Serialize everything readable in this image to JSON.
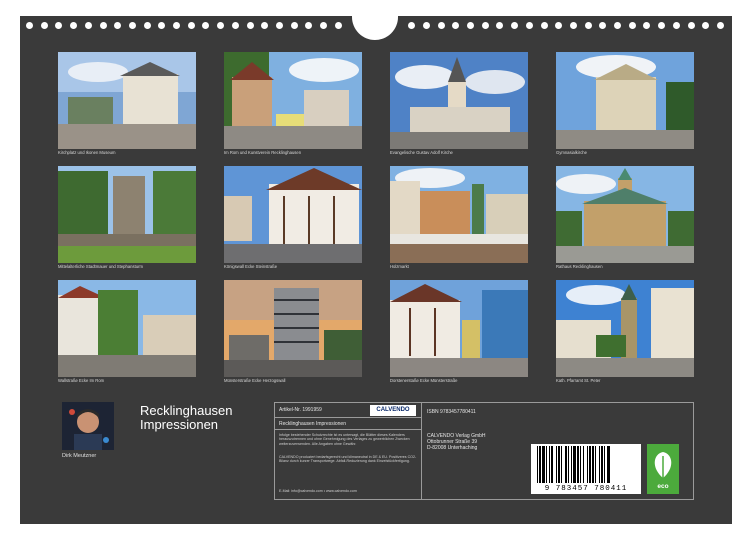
{
  "photos": [
    {
      "caption": "Kirchplatz und Ikonen Museum",
      "icon": "photo-kirchplatz"
    },
    {
      "caption": "Im Rom und Kunstverein Recklinghausen",
      "icon": "photo-im-rom"
    },
    {
      "caption": "Evangelische Gustav Adolf Kirche",
      "icon": "photo-gustav-adolf-kirche"
    },
    {
      "caption": "Gymnasialkirche",
      "icon": "photo-gymnasialkirche"
    },
    {
      "caption": "Mittelalterliche Stadtmauer und Stephansturm",
      "icon": "photo-stadtmauer"
    },
    {
      "caption": "Königswall Ecke Steinstraße",
      "icon": "photo-koenigswall"
    },
    {
      "caption": "Holzmarkt",
      "icon": "photo-holzmarkt"
    },
    {
      "caption": "Rathaus Recklinghausen",
      "icon": "photo-rathaus"
    },
    {
      "caption": "Wallstraße Ecke Im Rom",
      "icon": "photo-wallstrasse"
    },
    {
      "caption": "Münsterstraße Ecke Herzogswall",
      "icon": "photo-muensterstrasse"
    },
    {
      "caption": "Dorstenerstaße Ecke Münsterstraße",
      "icon": "photo-dorstener"
    },
    {
      "caption": "Kath. Pfarramt St. Peter",
      "icon": "photo-st-peter"
    }
  ],
  "author": "Dirk Meutzner",
  "title_line1": "Recklinghausen",
  "title_line2": "Impressionen",
  "info": {
    "article": "Artikel-Nr. 1991959",
    "brand": "CALVENDO",
    "calendar_title": "Recklinghausen Impressionen",
    "legal1": "Infolge bestehender Schutzrechte ist es untersagt, die Blätter dieses Kalenders herauszutrennen und ohne Genehmigung des Verlages zu gewerblichen Zwecken weiterzuverwenden. Alle Angaben ohne Gewähr.",
    "legal2": "CALVENDO produziert bedarfsgerecht und klimaneutral in DE & EU. Positiveres CO2-Bilanz durch kurzer Transportwege. Abfall-Reduzierung dank Einzelstückfertigung.",
    "contact": "E-Mail: info@calvendo.com • www.calvendo.com",
    "isbn": "ISBN 9783457780411",
    "publisher1": "CALVENDO Verlag GmbH",
    "publisher2": "Ottobrunner Straße 39",
    "publisher3": "D-82008 Unterhaching",
    "barcode_number": "9 783457 780411",
    "eco_label": "eco"
  },
  "colors": {
    "sheet": "#3a3a3a",
    "eco_green": "#4caa3c",
    "brand_blue": "#0b2a6b"
  }
}
